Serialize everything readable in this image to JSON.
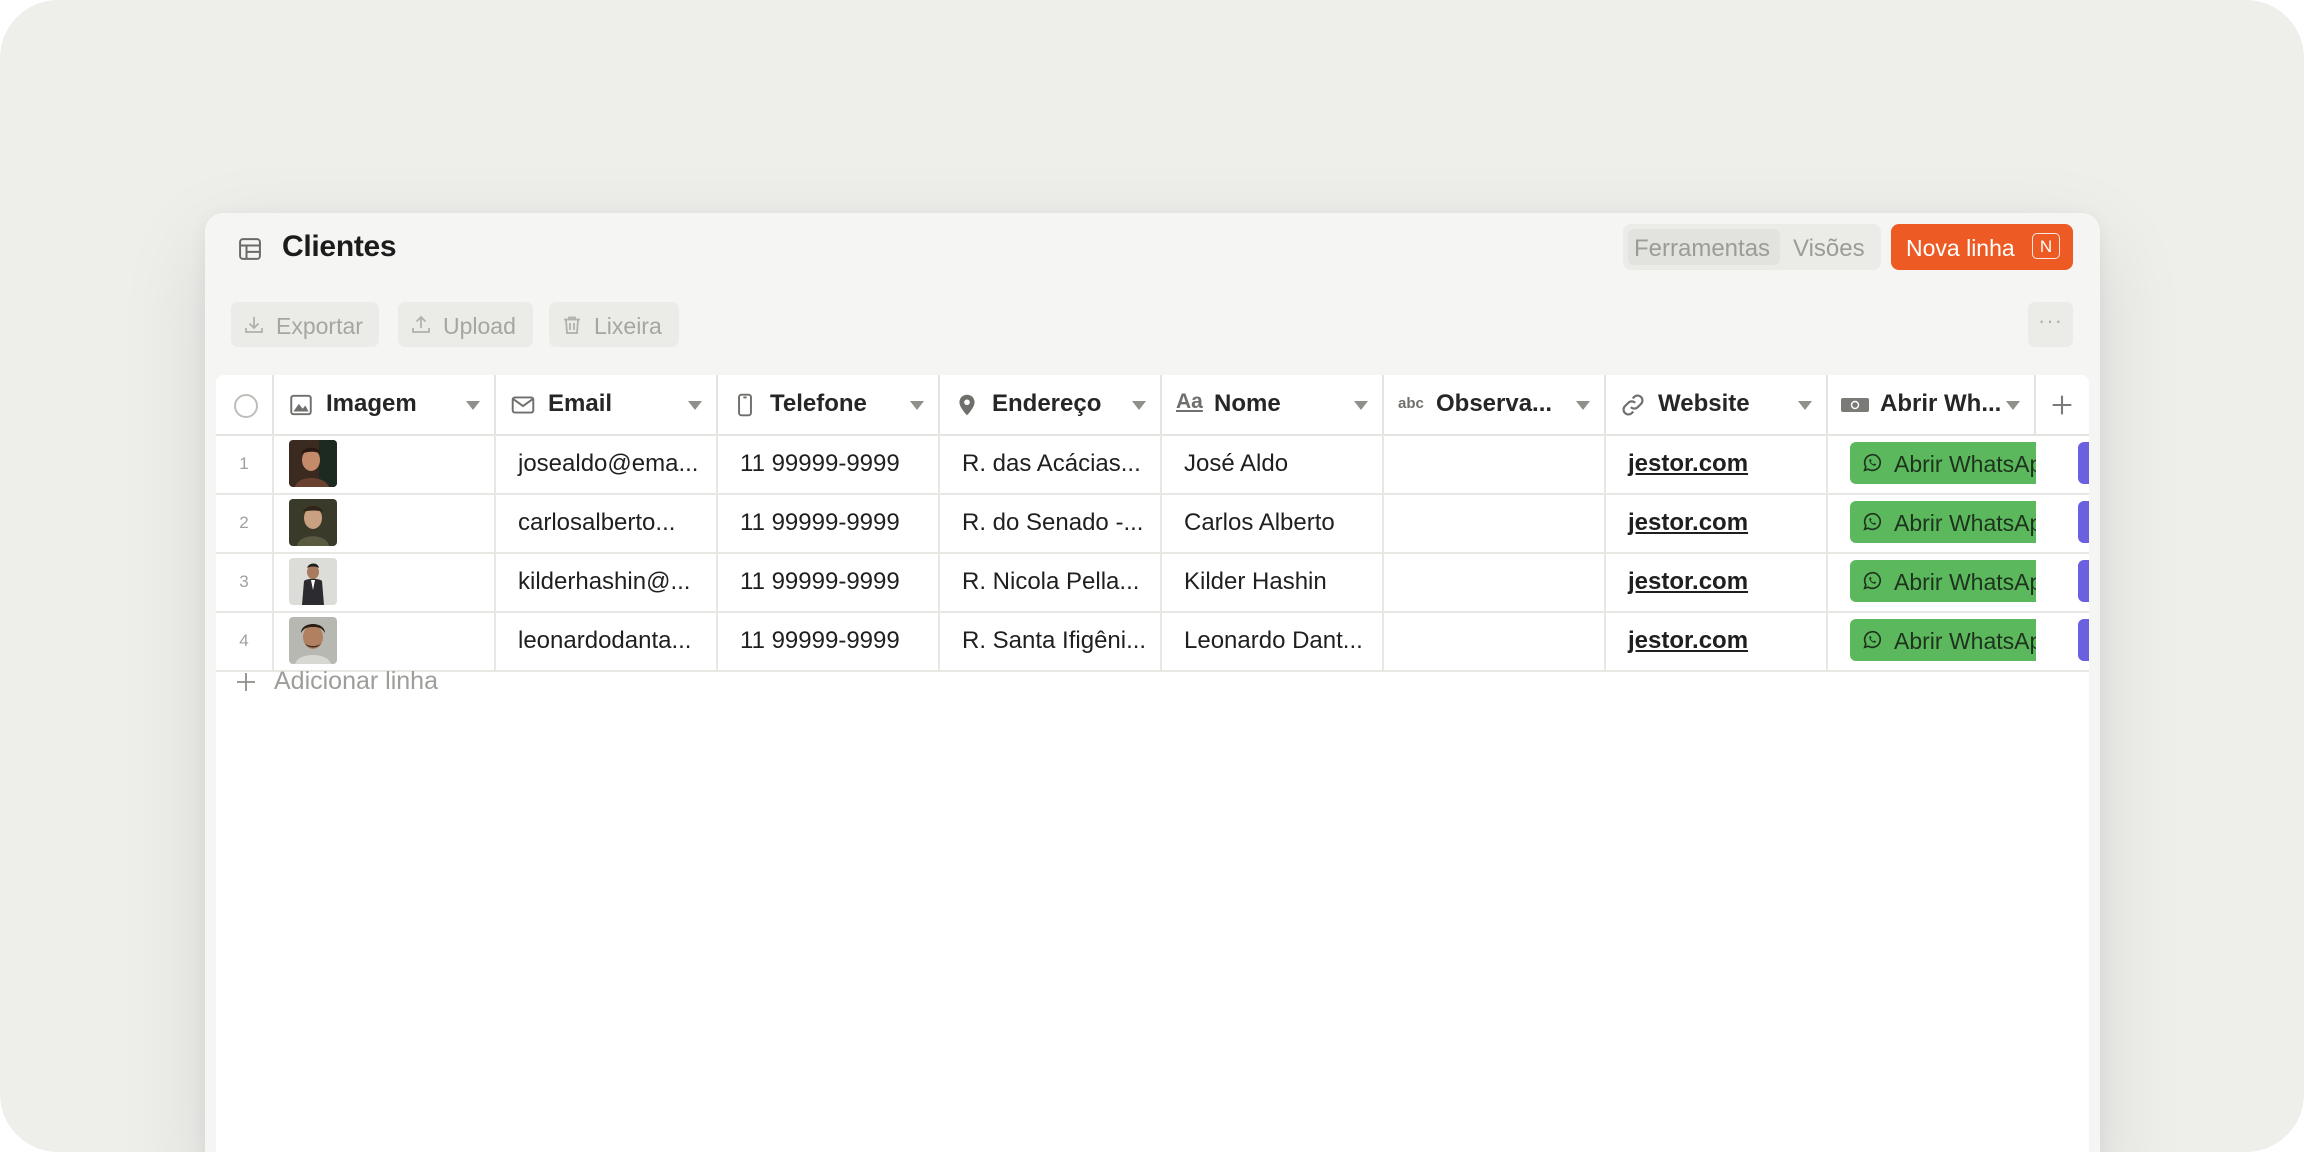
{
  "header": {
    "title": "Clientes",
    "icons": [
      "table-icon",
      "search-icon",
      "feed-icon",
      "filter-sliders-icon"
    ],
    "tabs": [
      {
        "label": "Ferramentas",
        "active": true
      },
      {
        "label": "Visões",
        "active": false
      }
    ],
    "new_row_label": "Nova linha",
    "new_row_shortcut": "N"
  },
  "toolbar": {
    "export_label": "Exportar",
    "upload_label": "Upload",
    "trash_label": "Lixeira",
    "more_label": "···"
  },
  "columns": [
    {
      "label": "Imagem",
      "icon": "image-icon"
    },
    {
      "label": "Email",
      "icon": "mail-icon"
    },
    {
      "label": "Telefone",
      "icon": "phone-icon"
    },
    {
      "label": "Endereço",
      "icon": "location-pin-icon"
    },
    {
      "label": "Nome",
      "icon": "text-aa-icon",
      "icon_text": "Aa"
    },
    {
      "label": "Observa...",
      "icon": "abc-text-icon",
      "icon_text": "abc"
    },
    {
      "label": "Website",
      "icon": "link-icon"
    },
    {
      "label": "Abrir Wh...",
      "icon": "button-icon"
    }
  ],
  "rows": [
    {
      "num": "1",
      "image": "photo-jose",
      "email": "josealdo@ema...",
      "telefone": "11 99999-9999",
      "endereco": "R. das Acácias...",
      "nome": "José Aldo",
      "observacao": "",
      "website": "jestor.com",
      "button": "Abrir WhatsApp"
    },
    {
      "num": "2",
      "image": "photo-carlos",
      "email": "carlosalberto...",
      "telefone": "11 99999-9999",
      "endereco": "R. do Senado -...",
      "nome": "Carlos Alberto",
      "observacao": "",
      "website": "jestor.com",
      "button": "Abrir WhatsApp"
    },
    {
      "num": "3",
      "image": "photo-kilder",
      "email": "kilderhashin@...",
      "telefone": "11 99999-9999",
      "endereco": "R. Nicola Pella...",
      "nome": "Kilder Hashin",
      "observacao": "",
      "website": "jestor.com",
      "button": "Abrir WhatsApp"
    },
    {
      "num": "4",
      "image": "photo-leonardo",
      "email": "leonardodanta...",
      "telefone": "11 99999-9999",
      "endereco": "R. Santa Ifigêni...",
      "nome": "Leonardo Dant...",
      "observacao": "",
      "website": "jestor.com",
      "button": "Abrir WhatsApp"
    }
  ],
  "add_row_label": "Adicionar linha",
  "colors": {
    "accent": "#ee5a24",
    "whatsapp_button": "#5cb85c",
    "secondary_button": "#6b61e0",
    "background": "#eeefeb"
  }
}
